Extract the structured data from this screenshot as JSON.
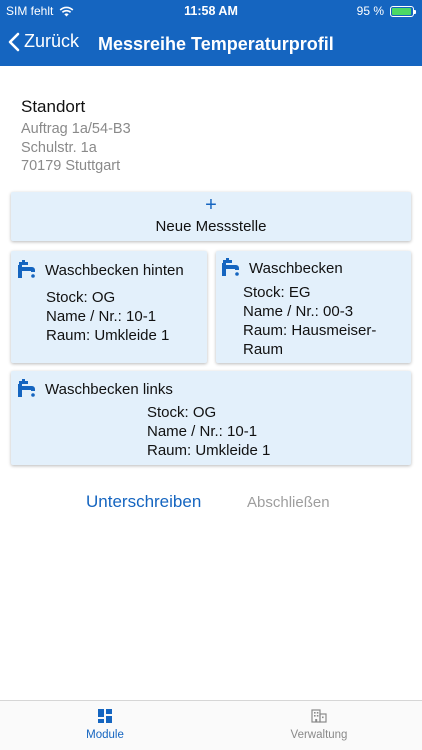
{
  "status": {
    "carrier": "SIM fehlt",
    "time": "11:58 AM",
    "battery_percent": "95 %",
    "battery_level": 0.95
  },
  "nav": {
    "back_label": "Zurück",
    "title": "Messreihe Temperaturprofil"
  },
  "location": {
    "title": "Standort",
    "lines": [
      "Auftrag 1a/54-B3",
      "Schulstr. 1a",
      "70179 Stuttgart"
    ]
  },
  "new_point": {
    "plus": "+",
    "label": "Neue Messstelle"
  },
  "measuring_points": [
    {
      "name": "Waschbecken hinten",
      "floor": "Stock: OG",
      "number": "Name / Nr.: 10-1",
      "room": "Raum: Umkleide 1"
    },
    {
      "name": "Waschbecken",
      "floor": "Stock: EG",
      "number": "Name / Nr.: 00-3",
      "room_line1": "Raum: Hausmeiser-",
      "room_line2": "Raum"
    },
    {
      "name": "Waschbecken links",
      "floor": "Stock: OG",
      "number": "Name / Nr.: 10-1",
      "room": "Raum: Umkleide 1"
    }
  ],
  "actions": {
    "sign": "Unterschreiben",
    "finish": "Abschließen"
  },
  "tabs": [
    {
      "label": "Module",
      "icon": "dashboard-icon",
      "active": true
    },
    {
      "label": "Verwaltung",
      "icon": "building-icon",
      "active": false
    }
  ],
  "colors": {
    "accent": "#1565c0",
    "card_bg": "#e3f0fb",
    "muted": "#8a8a8a",
    "disabled": "#9e9e9e"
  }
}
